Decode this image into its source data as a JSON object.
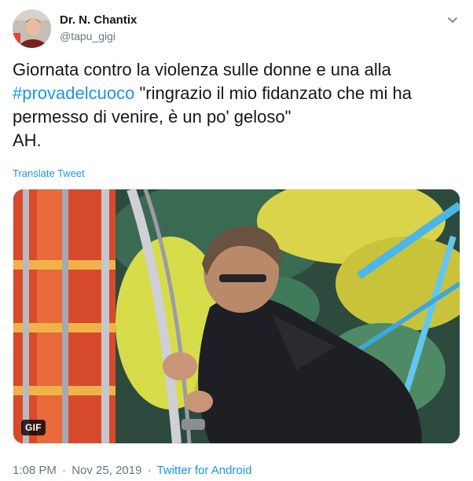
{
  "author": {
    "display_name": "Dr. N. Chantix",
    "handle": "@tapu_gigi"
  },
  "tweet": {
    "line1": "Giornata contro la violenza sulle donne e una alla",
    "hashtag": "#provadelcuoco",
    "line2_rest": " \"ringrazio il mio fidanzato che mi ha",
    "line3": "permesso di venire, è un po' geloso\"",
    "line4": "AH."
  },
  "translate_label": "Translate Tweet",
  "media": {
    "badge": "GIF"
  },
  "meta": {
    "time": "1:08 PM",
    "separator": "·",
    "date": "Nov 25, 2019",
    "source": "Twitter for Android"
  },
  "icons": {
    "more": "chevron-down-icon"
  },
  "colors": {
    "link": "#1b95e0",
    "secondary_text": "#657786",
    "primary_text": "#14171a"
  }
}
